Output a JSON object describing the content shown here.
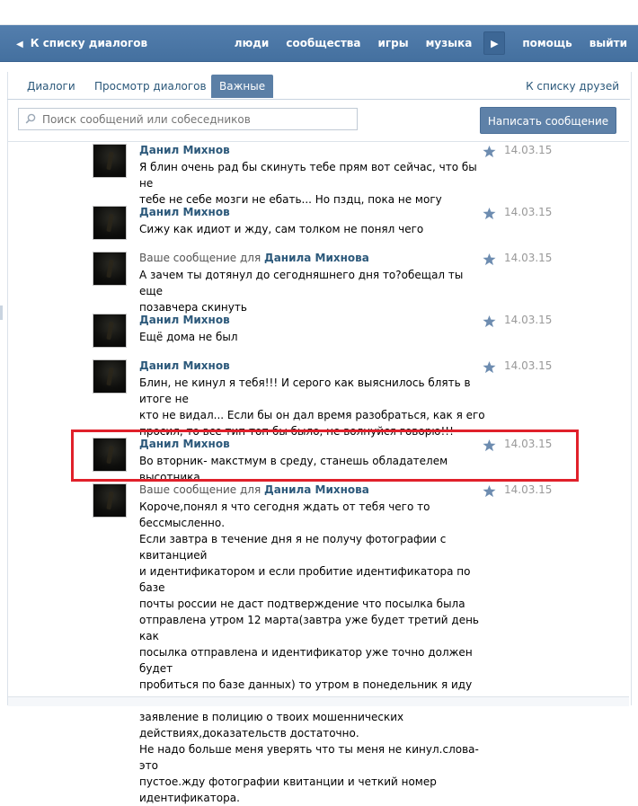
{
  "topbar": {
    "back_label": "К списку диалогов",
    "nav": [
      "люди",
      "сообщества",
      "игры",
      "музыка",
      "помощь",
      "выйти"
    ]
  },
  "tabs": {
    "items": [
      "Диалоги",
      "Просмотр диалогов",
      "Важные"
    ],
    "active": "Важные",
    "friends_link": "К списку друзей"
  },
  "search": {
    "placeholder": "Поиск сообщений или собеседников"
  },
  "write_button": "Написать сообщение",
  "messages": [
    {
      "prefix": "",
      "name": "Данил Михнов",
      "date": "14.03.15",
      "lines": [
        "Я блин очень рад бы скинуть тебе прям вот сейчас, что бы не",
        "тебе не себе мозги не ебать... Но пздц, пока не могу"
      ]
    },
    {
      "prefix": "",
      "name": "Данил Михнов",
      "date": "14.03.15",
      "lines": [
        "Сижу как идиот и жду, сам толком не понял чего"
      ]
    },
    {
      "prefix": "Ваше сообщение для",
      "name": "Данила Михнова",
      "date": "14.03.15",
      "lines": [
        "А зачем ты дотянул до сегодняшнего дня то?обещал ты еще",
        "позавчера скинуть"
      ]
    },
    {
      "prefix": "",
      "name": "Данил Михнов",
      "date": "14.03.15",
      "lines": [
        "Ещё дома не был"
      ]
    },
    {
      "prefix": "",
      "name": "Данил Михнов",
      "date": "14.03.15",
      "lines": [
        "Блин, не кинул я тебя!!! И серого как выяснилось блять в итоге не",
        "кто не видал... Если бы он дал время разобраться, как я его",
        "просил, то все тип топ бы было, не волнуйся говорю!!!"
      ]
    },
    {
      "prefix": "",
      "name": "Данил Михнов",
      "date": "14.03.15",
      "lines": [
        "Во вторник- макстмум в среду, станешь обладателем высотника"
      ]
    },
    {
      "prefix": "Ваше сообщение для",
      "name": "Данила Михнова",
      "date": "14.03.15",
      "lines": [
        "Короче,понял я что сегодня ждать от тебя чего то бессмысленно.",
        "Если завтра в течение дня я не получу фотографии с квитанцией",
        "и идентификатором и если пробитие идентификатора по базе",
        "почты россии не даст подтверждение что посылка была",
        "отправлена утром 12 марта(завтра уже будет третий день как",
        "посылка отправлена и идентификатор уже точно должен будет",
        "пробиться по базе данных) то утром в понедельник я иду писать",
        "заявление в полицию о твоих мошеннических",
        "действиях,доказательств достаточно.",
        "Не надо больше меня уверять что ты меня не кинул.слова-это",
        "пустое.жду фотографии квитанции и четкий номер",
        "идентификатора."
      ]
    }
  ],
  "colors": {
    "accent": "#4a76a8",
    "link": "#2b587a",
    "highlight": "#e0202a"
  }
}
